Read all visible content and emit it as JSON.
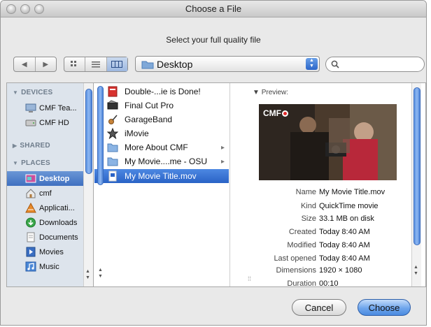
{
  "window": {
    "title": "Choose a File",
    "subtitle": "Select your full quality file"
  },
  "toolbar": {
    "back_icon": "back-arrow-icon",
    "forward_icon": "forward-arrow-icon",
    "views": [
      "icon-view",
      "list-view",
      "column-view"
    ],
    "active_view": "column-view",
    "location": "Desktop",
    "search_placeholder": ""
  },
  "sidebar": {
    "devices_heading": "DEVICES",
    "devices": [
      {
        "label": "CMF Tea...",
        "icon": "computer-icon"
      },
      {
        "label": "CMF HD",
        "icon": "hard-drive-icon"
      }
    ],
    "shared_heading": "SHARED",
    "places_heading": "PLACES",
    "places": [
      {
        "label": "Desktop",
        "icon": "desktop-icon",
        "selected": true
      },
      {
        "label": "cmf",
        "icon": "home-icon"
      },
      {
        "label": "Applicati...",
        "icon": "applications-icon"
      },
      {
        "label": "Downloads",
        "icon": "downloads-icon"
      },
      {
        "label": "Documents",
        "icon": "documents-icon"
      },
      {
        "label": "Movies",
        "icon": "movies-icon"
      },
      {
        "label": "Music",
        "icon": "music-icon"
      }
    ]
  },
  "files": [
    {
      "label": "Double-...ie is Done!",
      "icon": "pdf-icon"
    },
    {
      "label": "Final Cut Pro",
      "icon": "final-cut-pro-icon"
    },
    {
      "label": "GarageBand",
      "icon": "guitar-icon"
    },
    {
      "label": "iMovie",
      "icon": "star-icon"
    },
    {
      "label": "More About CMF",
      "icon": "folder-icon",
      "has_children": true
    },
    {
      "label": "My Movie....me - OSU",
      "icon": "folder-icon",
      "has_children": true
    },
    {
      "label": "My Movie Title.mov",
      "icon": "movie-file-icon",
      "selected": true
    }
  ],
  "preview": {
    "label": "Preview:",
    "logo_text": "CMF",
    "info": [
      {
        "key": "Name",
        "value": "My Movie Title.mov"
      },
      {
        "key": "Kind",
        "value": "QuickTime movie"
      },
      {
        "key": "Size",
        "value": "33.1 MB on disk"
      },
      {
        "key": "Created",
        "value": "Today 8:40 AM"
      },
      {
        "key": "Modified",
        "value": "Today 8:40 AM"
      },
      {
        "key": "Last opened",
        "value": "Today 8:40 AM"
      },
      {
        "key": "Dimensions",
        "value": "1920 × 1080"
      },
      {
        "key": "Duration",
        "value": "00:10"
      }
    ]
  },
  "buttons": {
    "cancel": "Cancel",
    "choose": "Choose"
  },
  "colors": {
    "selection": "#3f70c0",
    "sidebar_bg": "#dde4ec",
    "accent": "#4b8be0"
  }
}
